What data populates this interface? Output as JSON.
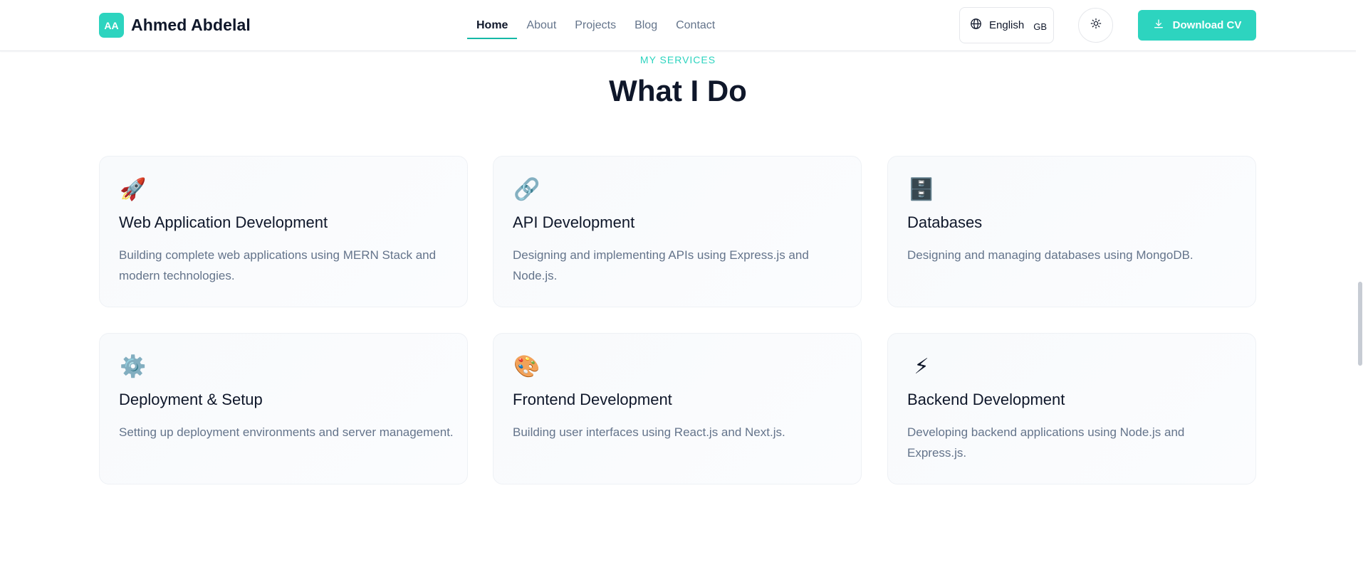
{
  "header": {
    "logo_initials": "AA",
    "brand_name": "Ahmed Abdelal",
    "nav": [
      {
        "label": "Home",
        "active": true
      },
      {
        "label": "About",
        "active": false
      },
      {
        "label": "Projects",
        "active": false
      },
      {
        "label": "Blog",
        "active": false
      },
      {
        "label": "Contact",
        "active": false
      }
    ],
    "language": {
      "label": "English",
      "code": "GB",
      "icon": "globe-icon"
    },
    "theme_toggle_icon": "sun-icon",
    "download_cv": {
      "label": "Download CV",
      "icon": "download-icon"
    }
  },
  "section": {
    "eyebrow": "MY SERVICES",
    "title": "What I Do"
  },
  "services": [
    {
      "icon": "rocket-icon",
      "emoji": "🚀",
      "title": "Web Application Development",
      "description": "Building complete web applications using MERN Stack and modern technologies."
    },
    {
      "icon": "link-icon",
      "emoji": "🔗",
      "title": "API Development",
      "description": "Designing and implementing APIs using Express.js and Node.js."
    },
    {
      "icon": "file-cabinet-icon",
      "emoji": "🗄️",
      "title": "Databases",
      "description": "Designing and managing databases using MongoDB."
    },
    {
      "icon": "gear-icon",
      "emoji": "⚙️",
      "title": "Deployment & Setup",
      "description": "Setting up deployment environments and server management."
    },
    {
      "icon": "palette-icon",
      "emoji": "🎨",
      "title": "Frontend Development",
      "description": "Building user interfaces using React.js and Next.js."
    },
    {
      "icon": "lightning-icon",
      "emoji": "⚡",
      "title": "Backend Development",
      "description": "Developing backend applications using Node.js and Express.js."
    }
  ],
  "colors": {
    "accent": "#2dd4bf",
    "accent_dark": "#14b8a6",
    "text_primary": "#0f172a",
    "text_muted": "#64748b"
  }
}
